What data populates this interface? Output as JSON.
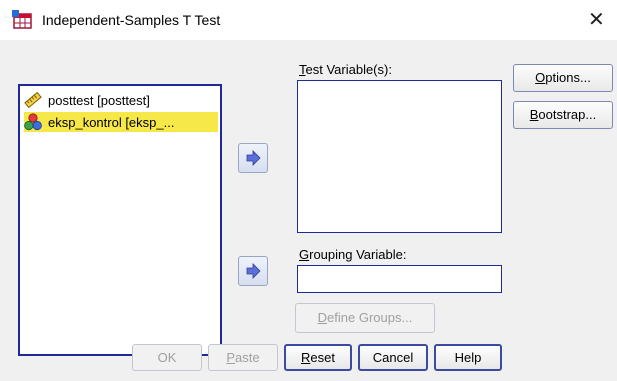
{
  "window": {
    "title": "Independent-Samples T Test",
    "close_glyph": "✕"
  },
  "source_list": {
    "items": [
      {
        "label": "posttest [posttest]",
        "icon": "scale-ruler-icon",
        "selected": false
      },
      {
        "label": "eksp_kontrol [eksp_...",
        "icon": "nominal-circles-icon",
        "selected": true
      }
    ]
  },
  "test_variables": {
    "label_mnemonic": "T",
    "label_rest": "est Variable(s):"
  },
  "grouping_variable": {
    "label_mnemonic": "G",
    "label_rest": "rouping Variable:",
    "value": ""
  },
  "define_groups": {
    "label_mnemonic": "D",
    "label_rest": "efine Groups...",
    "enabled": false
  },
  "side_buttons": {
    "options": {
      "mnemonic": "O",
      "rest": "ptions..."
    },
    "bootstrap": {
      "mnemonic": "B",
      "rest": "ootstrap..."
    }
  },
  "bottom_buttons": {
    "ok": {
      "label": "OK",
      "enabled": false
    },
    "paste": {
      "mnemonic": "P",
      "rest": "aste",
      "enabled": false
    },
    "reset": {
      "mnemonic": "R",
      "rest": "eset"
    },
    "cancel": {
      "label": "Cancel"
    },
    "help": {
      "label": "Help"
    }
  },
  "colors": {
    "list_border": "#1e2a96",
    "selection": "#f7e84a",
    "dialog_bg": "#f0f0f0"
  }
}
